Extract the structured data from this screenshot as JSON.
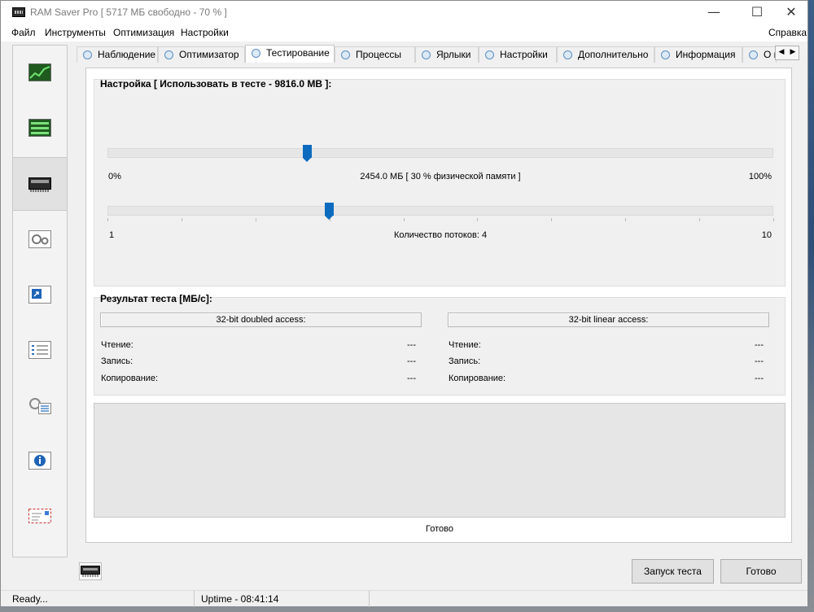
{
  "window": {
    "title": "RAM Saver Pro [ 5717 МБ свободно - 70 % ]",
    "controls": {
      "minimize": "—",
      "maximize": "☐",
      "close": "✕"
    }
  },
  "menu": {
    "items": [
      "Файл",
      "Инструменты",
      "Оптимизация",
      "Настройки"
    ],
    "help": "Справка"
  },
  "sidebar": {
    "items": [
      {
        "name": "monitor",
        "icon": "chart-icon"
      },
      {
        "name": "optimizer",
        "icon": "bars-icon"
      },
      {
        "name": "testing",
        "icon": "ram-chip-icon",
        "active": true
      },
      {
        "name": "processes",
        "icon": "gears-icon"
      },
      {
        "name": "shortcuts",
        "icon": "shortcut-icon"
      },
      {
        "name": "settings",
        "icon": "checklist-icon"
      },
      {
        "name": "additional",
        "icon": "gear-checklist-icon"
      },
      {
        "name": "info",
        "icon": "info-icon"
      },
      {
        "name": "about",
        "icon": "envelope-icon"
      }
    ]
  },
  "tabs": [
    {
      "label": "Наблюдение"
    },
    {
      "label": "Оптимизатор"
    },
    {
      "label": "Тестирование",
      "active": true
    },
    {
      "label": "Процессы"
    },
    {
      "label": "Ярлыки"
    },
    {
      "label": "Настройки"
    },
    {
      "label": "Дополнительно"
    },
    {
      "label": "Информация"
    },
    {
      "label": "О п"
    }
  ],
  "tab_arrows": {
    "left": "◀",
    "right": "▶"
  },
  "settings": {
    "title": "Настройка [ Использовать в тесте - 9816.0 MB ]:",
    "memory_slider": {
      "min_label": "0%",
      "max_label": "100%",
      "value_label": "2454.0 МБ [ 30 % физической памяти ]",
      "value_fraction": 0.3
    },
    "threads_slider": {
      "min_label": "1",
      "max_label": "10",
      "value_label": "Количество потоков: 4",
      "value": 4,
      "min": 1,
      "max": 10
    }
  },
  "results": {
    "title": "Результат теста [МБ/с]:",
    "doubled": {
      "header": "32-bit doubled access:",
      "rows": [
        {
          "label": "Чтение:",
          "value": "---"
        },
        {
          "label": "Запись:",
          "value": "---"
        },
        {
          "label": "Копирование:",
          "value": "---"
        }
      ]
    },
    "linear": {
      "header": "32-bit linear access:",
      "rows": [
        {
          "label": "Чтение:",
          "value": "---"
        },
        {
          "label": "Запись:",
          "value": "---"
        },
        {
          "label": "Копирование:",
          "value": "---"
        }
      ]
    }
  },
  "progress_status": "Готово",
  "buttons": {
    "start_test": "Запуск теста",
    "done": "Готово"
  },
  "statusbar": {
    "state": "Ready...",
    "uptime": "Uptime - 08:41:14"
  }
}
